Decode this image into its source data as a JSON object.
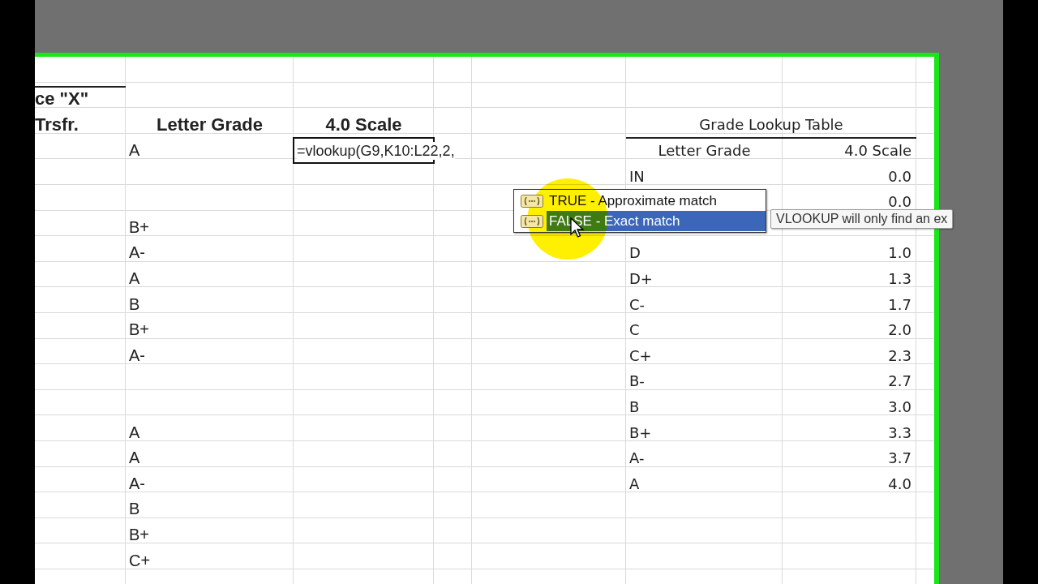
{
  "sheet": {
    "rows": [
      {},
      {
        "column_1": "ce \"X\""
      },
      {
        "column_1": "Trsfr.",
        "letter_grade_header": "Letter Grade",
        "scale_header": "4.0 Scale",
        "lookup_title": "Grade Lookup Table"
      },
      {
        "letter_grade": "A",
        "formula": "=vlookup(G9,K10:L22,2,",
        "lookup_letter_header": "Letter Grade",
        "lookup_scale_header": "4.0 Scale"
      },
      {
        "lookup_letter": "IN",
        "lookup_scale": "0.0"
      },
      {
        "lookup_scale": "0.0"
      },
      {
        "letter_grade": "B+"
      },
      {
        "letter_grade": "A-",
        "lookup_letter": "D",
        "lookup_scale": "1.0"
      },
      {
        "letter_grade": "A",
        "lookup_letter": "D+",
        "lookup_scale": "1.3"
      },
      {
        "letter_grade": "B",
        "lookup_letter": "C-",
        "lookup_scale": "1.7"
      },
      {
        "letter_grade": "B+",
        "lookup_letter": "C",
        "lookup_scale": "2.0"
      },
      {
        "letter_grade": "A-",
        "lookup_letter": "C+",
        "lookup_scale": "2.3"
      },
      {
        "lookup_letter": "B-",
        "lookup_scale": "2.7"
      },
      {
        "lookup_letter": "B",
        "lookup_scale": "3.0"
      },
      {
        "letter_grade": "A",
        "lookup_letter": "B+",
        "lookup_scale": "3.3"
      },
      {
        "letter_grade": "A",
        "lookup_letter": "A-",
        "lookup_scale": "3.7"
      },
      {
        "letter_grade": "A-",
        "lookup_letter": "A",
        "lookup_scale": "4.0"
      },
      {
        "letter_grade": "B"
      },
      {
        "letter_grade": "B+"
      },
      {
        "letter_grade": "C+"
      },
      {}
    ]
  },
  "autocomplete": {
    "items": [
      {
        "label": "TRUE - Approximate match",
        "selected": false
      },
      {
        "label": "FALSE - Exact match",
        "selected": true
      }
    ]
  },
  "tooltip": {
    "text": "VLOOKUP will only find an ex"
  }
}
